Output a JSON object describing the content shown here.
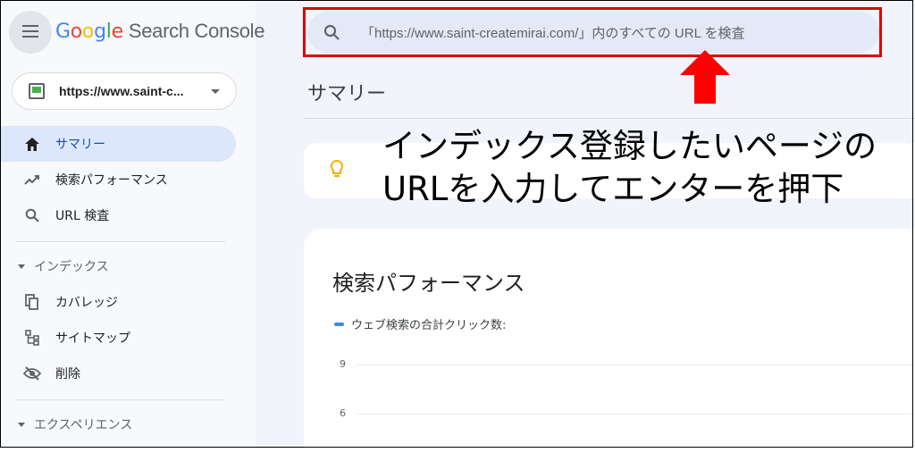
{
  "app": {
    "logo_letters": [
      "G",
      "o",
      "o",
      "g",
      "l",
      "e"
    ],
    "product": "Search Console"
  },
  "property": {
    "label": "https://www.saint-c..."
  },
  "search": {
    "placeholder": "「https://www.saint-createmirai.com/」内のすべての URL を検査"
  },
  "sidebar": {
    "items": [
      {
        "label": "サマリー",
        "icon": "home-icon",
        "active": true
      },
      {
        "label": "検索パフォーマンス",
        "icon": "trending-up-icon"
      },
      {
        "label": "URL 検査",
        "icon": "search-icon"
      }
    ],
    "sections": [
      {
        "label": "インデックス",
        "items": [
          {
            "label": "カバレッジ",
            "icon": "copy-icon"
          },
          {
            "label": "サイトマップ",
            "icon": "sitemap-icon"
          },
          {
            "label": "削除",
            "icon": "eye-off-icon"
          }
        ]
      },
      {
        "label": "エクスペリエンス"
      }
    ]
  },
  "main": {
    "title": "サマリー",
    "performance": {
      "title": "検索パフォーマンス",
      "legend": "ウェブ検索の合計クリック数:",
      "ticks": [
        "9",
        "6"
      ]
    }
  },
  "annotation": {
    "line1": "インデックス登録したいページの",
    "line2": "URLを入力してエンターを押下"
  },
  "colors": {
    "highlight_box": "#e00000",
    "arrow": "#ff0000",
    "accent": "#1a73e8",
    "series": "#4285f4"
  }
}
